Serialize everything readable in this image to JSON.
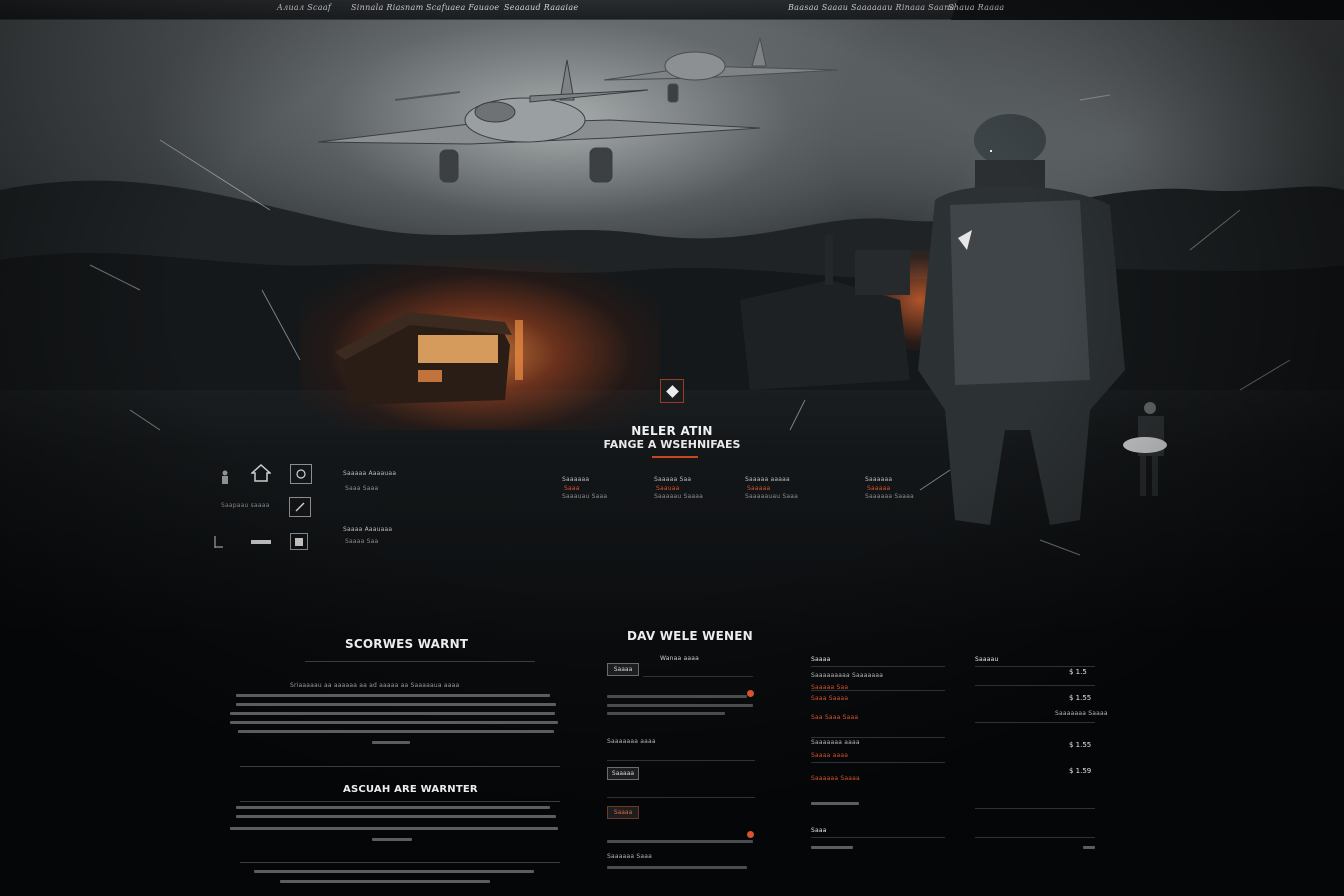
{
  "nav": {
    "items_left": [
      "Aлиал Scaaf",
      "Sinnala Riasnam",
      "Scafuaea Fauaoe",
      "Seaaaud Raaaiae"
    ],
    "items_right": [
      "Baasaa Saaau",
      "Saaaaaau Rinaaa Saana",
      "Shaua Raaaa"
    ]
  },
  "hero": {
    "title": "NELER ATIN",
    "subtitle": "FANGE A WSEHNIFAES"
  },
  "left_cluster": {
    "label_1": "Saapaau saaaa",
    "label_2": "Saaaaa Aaaauaa",
    "label_2_sub": "Saaa Saaa",
    "label_3": "Saaaa Aaauaaa",
    "label_3_sub": "Saaaa Saa"
  },
  "hero_columns": [
    {
      "title": "Saaaaaa",
      "l1": "Saaa",
      "l2": "Saaauau Saaa"
    },
    {
      "title": "Saaaaa Saa",
      "l1": "Saauaa",
      "l2": "Saaaaau Saaaa"
    },
    {
      "title": "Saaaaa aaaaa",
      "l1": "Saaaaa",
      "l2": "Saaaaauau Saaa"
    },
    {
      "title": "Saaaaaa",
      "l1": "Saaaaa",
      "l2": "Saaaaaa Saaaa"
    }
  ],
  "services": {
    "title": "SCORWES WARNT",
    "subtitle": "Sriaaaaau aa aaaaaa aa ad aaaaa aa Saaaaaua aaaa",
    "section2_title": "ASCUAH ARE WARNTER"
  },
  "news": {
    "title": "DAV WELE WENEN",
    "subtitle": "Wanaa aaaa",
    "chip1": "Saaaa",
    "item1_meta": "Saaaaaaa aaaa",
    "chip2": "Saaaaa",
    "chip3": "Saaaa",
    "item3_meta": "Saaaaaa Saaa"
  },
  "pricing": {
    "col1_title": "Saaaa",
    "col1_rows": [
      "Saaaaaaaaa Saaaaaaa",
      "Saaaaa Saa",
      "Saaa Saaaa",
      "Saa Saaa Saaa",
      "Saaaaaaa aaaa",
      "Saaaa aaaa",
      "Saaaaaa Saaaa"
    ],
    "col1_footer_title": "Saaa",
    "col2_title": "Saaaau",
    "col2_prices": [
      "$ 1.5",
      "$ 1.55",
      "$ 1.55",
      "$ 1.59"
    ],
    "col2_note": "Saaaaaaa Saaaa"
  }
}
